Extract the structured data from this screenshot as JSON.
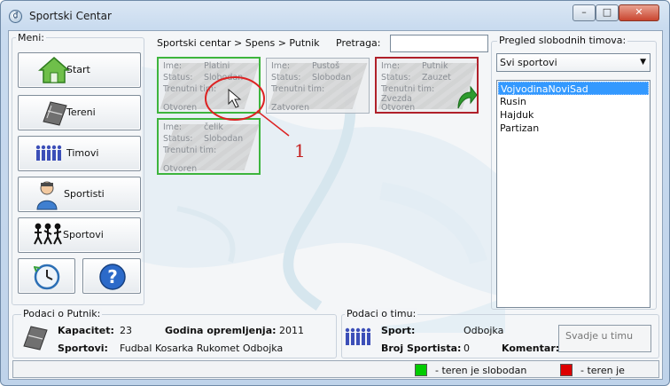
{
  "window": {
    "title": "Sportski Centar"
  },
  "menu": {
    "label": "Meni:",
    "items": [
      "Start",
      "Tereni",
      "Timovi",
      "Sportisti",
      "Sportovi"
    ]
  },
  "header": {
    "breadcrumb": "Sportski centar > Spens > Putnik",
    "search_label": "Pretraga:",
    "search_value": ""
  },
  "cards_labels": {
    "name": "Ime:",
    "status": "Status:",
    "team": "Trenutni tim:"
  },
  "cards": [
    {
      "name": "Platini",
      "status": "Slobodan",
      "team": "",
      "state": "Otvoren",
      "border": "green"
    },
    {
      "name": "Pustoš",
      "status": "Slobodan",
      "team": "",
      "state": "Zatvoren",
      "border": "gray"
    },
    {
      "name": "Putnik",
      "status": "Zauzet",
      "team": "Zvezda",
      "state": "Otvoren",
      "border": "red"
    },
    {
      "name": "čelik",
      "status": "Slobodan",
      "team": "",
      "state": "Otvoren",
      "border": "green"
    }
  ],
  "annotation": {
    "number": "1"
  },
  "free_teams": {
    "label": "Pregled slobodnih timova:",
    "filter_selected": "Svi sportovi",
    "teams": [
      "VojvodinaNoviSad",
      "Rusin",
      "Hajduk",
      "Partizan"
    ],
    "selected_index": 0
  },
  "court_info": {
    "label": "Podaci o Putnik:",
    "capacity_label": "Kapacitet:",
    "capacity_value": "23",
    "year_label": "Godina opremljenja:",
    "year_value": "2011",
    "sports_label": "Sportovi:",
    "sports_value": "Fudbal Kosarka Rukomet Odbojka"
  },
  "team_info": {
    "label": "Podaci o timu:",
    "sport_label": "Sport:",
    "sport_value": "Odbojka",
    "count_label": "Broj Sportista:",
    "count_value": "0",
    "comment_label": "Komentar:",
    "comment_value": "Svadje u timu"
  },
  "legend": {
    "free": "- teren je slobodan",
    "busy": "- teren je zauzet",
    "free_color": "#00cc00",
    "busy_color": "#dd0000"
  }
}
